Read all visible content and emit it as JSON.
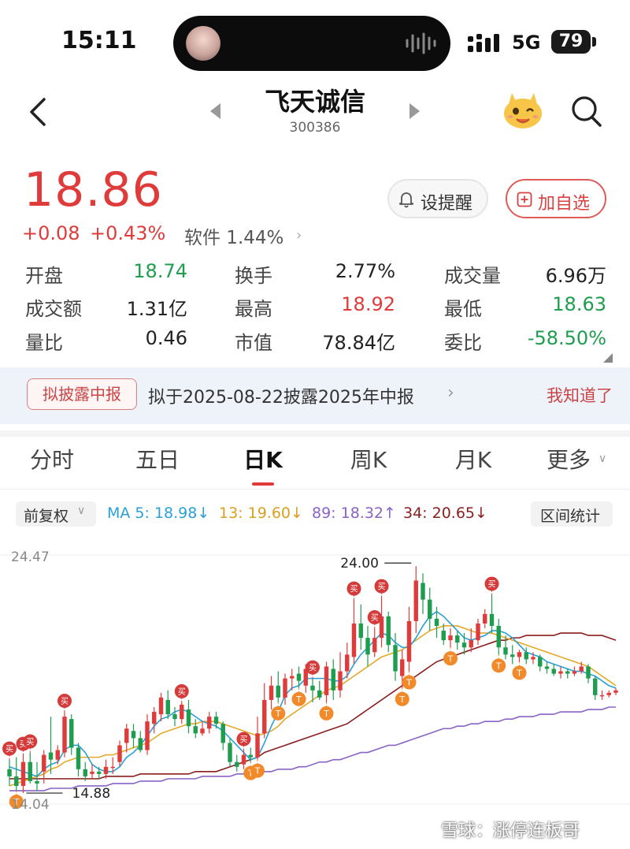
{
  "status_bar": {
    "time": "15:11",
    "network": "5G",
    "battery": "79"
  },
  "header": {
    "stock_name": "飞天诚信",
    "stock_code": "300386"
  },
  "quote": {
    "price": "18.86",
    "change": "+0.08",
    "change_pct": "+0.43%",
    "sector": "软件 1.44%",
    "alert_label": "设提醒",
    "watch_label": "加自选"
  },
  "stats": [
    {
      "label": "开盘",
      "value": "18.74",
      "color": "green"
    },
    {
      "label": "换手",
      "value": "2.77%",
      "color": "dark"
    },
    {
      "label": "成交量",
      "value": "6.96万",
      "color": "dark"
    },
    {
      "label": "成交额",
      "value": "1.31亿",
      "color": "dark"
    },
    {
      "label": "最高",
      "value": "18.92",
      "color": "red"
    },
    {
      "label": "最低",
      "value": "18.63",
      "color": "green"
    },
    {
      "label": "量比",
      "value": "0.46",
      "color": "dark"
    },
    {
      "label": "市值",
      "value": "78.84亿",
      "color": "dark"
    },
    {
      "label": "委比",
      "value": "-58.50%",
      "color": "green"
    }
  ],
  "banner": {
    "tag": "拟披露中报",
    "text": "拟于2025-08-22披露2025年中报",
    "dismiss": "我知道了"
  },
  "tabs": [
    "分时",
    "五日",
    "日K",
    "周K",
    "月K",
    "更多"
  ],
  "active_tab": "日K",
  "indicators": {
    "adjust": "前复权",
    "ma5": "MA 5: 18.98↓",
    "ma13": "13: 19.60↓",
    "ma89": "89: 18.32↑",
    "ma34": "34: 20.65↓",
    "range": "区间统计"
  },
  "colors": {
    "up": "#e03b3b",
    "down": "#1f9d4f",
    "ma5": "#2aa0d8",
    "ma13": "#e3a92b",
    "ma89": "#8a63c7",
    "ma34": "#8b1e1e",
    "buy_marker": "#d43b3b",
    "t_marker": "#f08a2a"
  },
  "chart_data": {
    "type": "candlestick",
    "y_labels": {
      "top": "24.47",
      "bottom": "14.04"
    },
    "annotations": {
      "max_label": "24.00",
      "min_label": "14.88"
    },
    "ylim": [
      14.04,
      24.47
    ],
    "candles": [
      [
        15.5,
        15.2,
        15.9,
        14.8
      ],
      [
        15.2,
        14.8,
        16.0,
        14.6
      ],
      [
        14.8,
        15.8,
        16.1,
        14.5
      ],
      [
        15.8,
        15.0,
        16.2,
        14.9
      ],
      [
        15.0,
        14.9,
        15.8,
        14.6
      ],
      [
        15.4,
        16.1,
        16.3,
        14.9
      ],
      [
        16.2,
        15.9,
        17.7,
        15.3
      ],
      [
        15.9,
        16.3,
        16.5,
        15.7
      ],
      [
        16.2,
        17.7,
        17.9,
        16.0
      ],
      [
        17.6,
        16.4,
        17.8,
        16.1
      ],
      [
        16.4,
        15.5,
        16.6,
        15.2
      ],
      [
        15.5,
        15.2,
        15.8,
        15.0
      ],
      [
        15.3,
        15.4,
        15.7,
        15.1
      ],
      [
        15.4,
        15.3,
        15.6,
        15.1
      ],
      [
        15.3,
        15.6,
        15.9,
        15.1
      ],
      [
        15.6,
        15.6,
        16.0,
        15.3
      ],
      [
        15.8,
        16.5,
        16.7,
        15.6
      ],
      [
        16.6,
        17.2,
        17.4,
        16.2
      ],
      [
        17.1,
        16.8,
        17.4,
        16.4
      ],
      [
        16.8,
        16.3,
        17.1,
        16.2
      ],
      [
        16.3,
        17.5,
        17.8,
        16.1
      ],
      [
        17.4,
        17.9,
        18.1,
        17.0
      ],
      [
        17.8,
        18.5,
        18.7,
        17.5
      ],
      [
        18.4,
        17.8,
        18.8,
        17.6
      ],
      [
        17.8,
        17.6,
        18.1,
        17.3
      ],
      [
        17.6,
        18.2,
        18.3,
        17.4
      ],
      [
        18.0,
        17.3,
        18.4,
        17.0
      ],
      [
        17.3,
        17.0,
        17.6,
        16.8
      ],
      [
        17.0,
        17.2,
        17.5,
        16.9
      ],
      [
        17.2,
        17.7,
        17.9,
        17.0
      ],
      [
        17.7,
        17.4,
        17.9,
        17.2
      ],
      [
        17.4,
        16.6,
        17.5,
        16.3
      ],
      [
        16.6,
        15.8,
        16.8,
        15.6
      ],
      [
        15.8,
        15.6,
        16.1,
        15.4
      ],
      [
        15.7,
        16.1,
        16.3,
        15.5
      ],
      [
        16.1,
        16.0,
        16.4,
        15.8
      ],
      [
        16.0,
        17.0,
        17.7,
        15.9
      ],
      [
        17.0,
        18.4,
        19.1,
        16.8
      ],
      [
        18.4,
        19.0,
        19.4,
        18.0
      ],
      [
        19.0,
        18.5,
        19.6,
        18.3
      ],
      [
        18.5,
        19.3,
        19.5,
        18.2
      ],
      [
        19.3,
        19.4,
        19.7,
        18.8
      ],
      [
        19.5,
        19.2,
        19.8,
        18.9
      ],
      [
        19.0,
        19.7,
        19.9,
        18.7
      ],
      [
        19.0,
        18.8,
        19.3,
        18.3
      ],
      [
        18.8,
        18.5,
        19.2,
        18.4
      ],
      [
        18.6,
        19.8,
        20.0,
        18.3
      ],
      [
        19.7,
        18.8,
        20.1,
        18.4
      ],
      [
        18.8,
        19.6,
        20.4,
        18.5
      ],
      [
        19.6,
        20.3,
        20.8,
        19.3
      ],
      [
        20.2,
        21.6,
        22.6,
        19.9
      ],
      [
        21.6,
        21.0,
        22.4,
        20.5
      ],
      [
        21.0,
        20.3,
        21.5,
        19.8
      ],
      [
        20.4,
        21.0,
        21.4,
        20.2
      ],
      [
        21.0,
        21.9,
        22.7,
        20.6
      ],
      [
        21.9,
        20.7,
        22.1,
        20.4
      ],
      [
        20.7,
        19.6,
        21.2,
        19.2
      ],
      [
        19.4,
        20.1,
        20.5,
        18.9
      ],
      [
        20.0,
        21.7,
        22.3,
        19.6
      ],
      [
        21.7,
        23.4,
        24.0,
        21.2
      ],
      [
        23.3,
        22.6,
        23.7,
        22.0
      ],
      [
        22.6,
        21.8,
        23.1,
        21.3
      ],
      [
        21.8,
        21.5,
        22.3,
        21.0
      ],
      [
        21.3,
        20.9,
        21.6,
        20.7
      ],
      [
        20.9,
        21.1,
        21.4,
        20.6
      ],
      [
        21.1,
        20.8,
        21.3,
        20.5
      ],
      [
        20.8,
        20.6,
        21.2,
        20.3
      ],
      [
        20.6,
        20.9,
        21.4,
        20.4
      ],
      [
        20.9,
        21.6,
        21.8,
        20.7
      ],
      [
        21.6,
        22.0,
        22.2,
        21.4
      ],
      [
        22.0,
        21.5,
        22.8,
        21.2
      ],
      [
        21.5,
        20.6,
        21.8,
        20.3
      ],
      [
        20.6,
        20.3,
        21.1,
        20.1
      ],
      [
        20.3,
        20.2,
        20.7,
        19.9
      ],
      [
        20.2,
        20.4,
        20.5,
        20.0
      ],
      [
        20.4,
        20.1,
        20.6,
        19.9
      ],
      [
        20.1,
        20.2,
        20.4,
        19.9
      ],
      [
        20.2,
        19.8,
        20.3,
        19.6
      ],
      [
        19.8,
        19.7,
        20.0,
        19.5
      ],
      [
        19.7,
        19.5,
        19.9,
        19.4
      ],
      [
        19.5,
        19.6,
        19.8,
        19.3
      ],
      [
        19.6,
        19.5,
        19.7,
        19.3
      ],
      [
        19.5,
        19.6,
        19.8,
        19.4
      ],
      [
        19.6,
        19.8,
        20.0,
        19.5
      ],
      [
        19.8,
        19.3,
        19.9,
        19.1
      ],
      [
        19.3,
        18.6,
        19.4,
        18.4
      ],
      [
        18.6,
        18.6,
        18.8,
        18.4
      ],
      [
        18.6,
        18.7,
        18.8,
        18.5
      ],
      [
        18.7,
        18.8,
        18.9,
        18.6
      ]
    ],
    "ma5": [
      15.6,
      15.5,
      15.4,
      15.3,
      15.2,
      15.5,
      15.7,
      15.8,
      16.3,
      16.5,
      16.5,
      16.2,
      15.7,
      15.5,
      15.4,
      15.4,
      15.6,
      16.0,
      16.2,
      16.5,
      16.9,
      17.3,
      17.6,
      17.7,
      17.9,
      18.0,
      17.9,
      17.7,
      17.5,
      17.4,
      17.3,
      17.1,
      16.8,
      16.5,
      16.2,
      15.9,
      16.0,
      16.6,
      17.3,
      17.9,
      18.6,
      18.9,
      19.0,
      19.3,
      19.3,
      19.3,
      19.3,
      19.2,
      19.2,
      19.4,
      19.9,
      20.3,
      20.6,
      20.9,
      21.2,
      21.1,
      20.8,
      20.6,
      20.6,
      21.0,
      21.5,
      21.9,
      22.1,
      21.9,
      21.6,
      21.3,
      21.0,
      20.9,
      21.0,
      21.1,
      21.3,
      21.3,
      21.2,
      21.0,
      20.7,
      20.4,
      20.3,
      20.2,
      20.0,
      19.9,
      19.8,
      19.7,
      19.6,
      19.6,
      19.5,
      19.4,
      19.2,
      19.0,
      18.9
    ],
    "ma13": [
      14.8,
      14.9,
      15.0,
      15.1,
      15.2,
      15.3,
      15.5,
      15.6,
      15.8,
      15.9,
      16.0,
      16.0,
      16.0,
      16.0,
      16.1,
      16.1,
      16.2,
      16.3,
      16.4,
      16.5,
      16.6,
      16.8,
      17.0,
      17.1,
      17.2,
      17.3,
      17.4,
      17.4,
      17.5,
      17.5,
      17.5,
      17.4,
      17.3,
      17.2,
      17.1,
      17.0,
      16.9,
      17.0,
      17.1,
      17.3,
      17.6,
      17.8,
      18.0,
      18.2,
      18.4,
      18.6,
      18.8,
      18.9,
      19.0,
      19.2,
      19.4,
      19.6,
      19.8,
      20.0,
      20.2,
      20.3,
      20.4,
      20.5,
      20.7,
      20.9,
      21.1,
      21.3,
      21.4,
      21.5,
      21.5,
      21.5,
      21.4,
      21.3,
      21.2,
      21.2,
      21.2,
      21.1,
      21.0,
      20.9,
      20.8,
      20.7,
      20.6,
      20.5,
      20.4,
      20.3,
      20.2,
      20.1,
      20.0,
      19.9,
      19.8,
      19.6,
      19.4,
      19.2,
      19.0
    ],
    "ma34": [
      15.1,
      15.1,
      15.1,
      15.1,
      15.1,
      15.1,
      15.1,
      15.1,
      15.1,
      15.1,
      15.1,
      15.1,
      15.1,
      15.1,
      15.2,
      15.2,
      15.2,
      15.2,
      15.2,
      15.3,
      15.3,
      15.3,
      15.3,
      15.3,
      15.3,
      15.3,
      15.3,
      15.4,
      15.4,
      15.4,
      15.4,
      15.5,
      15.6,
      15.7,
      15.8,
      15.9,
      16.0,
      16.2,
      16.3,
      16.4,
      16.5,
      16.6,
      16.7,
      16.8,
      16.9,
      17.0,
      17.1,
      17.2,
      17.3,
      17.4,
      17.6,
      17.8,
      18.0,
      18.2,
      18.4,
      18.6,
      18.8,
      19.0,
      19.2,
      19.4,
      19.6,
      19.8,
      20.0,
      20.1,
      20.2,
      20.3,
      20.4,
      20.5,
      20.6,
      20.7,
      20.8,
      20.9,
      20.9,
      21.0,
      21.0,
      21.1,
      21.1,
      21.1,
      21.1,
      21.1,
      21.2,
      21.2,
      21.2,
      21.2,
      21.1,
      21.1,
      21.1,
      21.0,
      20.9
    ],
    "ma89": [
      14.6,
      14.6,
      14.6,
      14.6,
      14.6,
      14.6,
      14.7,
      14.7,
      14.7,
      14.7,
      14.8,
      14.8,
      14.8,
      14.8,
      14.8,
      14.9,
      14.9,
      14.9,
      14.9,
      15.0,
      15.0,
      15.0,
      15.0,
      15.1,
      15.1,
      15.1,
      15.1,
      15.1,
      15.2,
      15.2,
      15.2,
      15.2,
      15.2,
      15.3,
      15.3,
      15.3,
      15.3,
      15.4,
      15.4,
      15.5,
      15.5,
      15.5,
      15.6,
      15.6,
      15.7,
      15.8,
      15.8,
      15.9,
      15.9,
      16.0,
      16.1,
      16.2,
      16.2,
      16.3,
      16.4,
      16.5,
      16.5,
      16.6,
      16.7,
      16.8,
      16.9,
      17.0,
      17.1,
      17.2,
      17.2,
      17.3,
      17.3,
      17.4,
      17.4,
      17.5,
      17.5,
      17.5,
      17.6,
      17.6,
      17.7,
      17.7,
      17.7,
      17.8,
      17.8,
      17.8,
      17.9,
      17.9,
      17.9,
      17.9,
      18.0,
      18.0,
      18.0,
      18.1,
      18.1
    ],
    "markers": [
      {
        "i": 0,
        "type": "买"
      },
      {
        "i": 1,
        "type": "T"
      },
      {
        "i": 2,
        "type": "买"
      },
      {
        "i": 3,
        "type": "买"
      },
      {
        "i": 8,
        "type": "买"
      },
      {
        "i": 25,
        "type": "买"
      },
      {
        "i": 34,
        "type": "买"
      },
      {
        "i": 35,
        "type": "T"
      },
      {
        "i": 36,
        "type": "T"
      },
      {
        "i": 39,
        "type": "T"
      },
      {
        "i": 42,
        "type": "T"
      },
      {
        "i": 44,
        "type": "买"
      },
      {
        "i": 46,
        "type": "T"
      },
      {
        "i": 50,
        "type": "买"
      },
      {
        "i": 53,
        "type": "买"
      },
      {
        "i": 54,
        "type": "买"
      },
      {
        "i": 57,
        "type": "T"
      },
      {
        "i": 58,
        "type": "T"
      },
      {
        "i": 64,
        "type": "T"
      },
      {
        "i": 70,
        "type": "买"
      },
      {
        "i": 71,
        "type": "T"
      },
      {
        "i": 74,
        "type": "T"
      }
    ]
  },
  "watermark": "雪球：涨停连板哥"
}
